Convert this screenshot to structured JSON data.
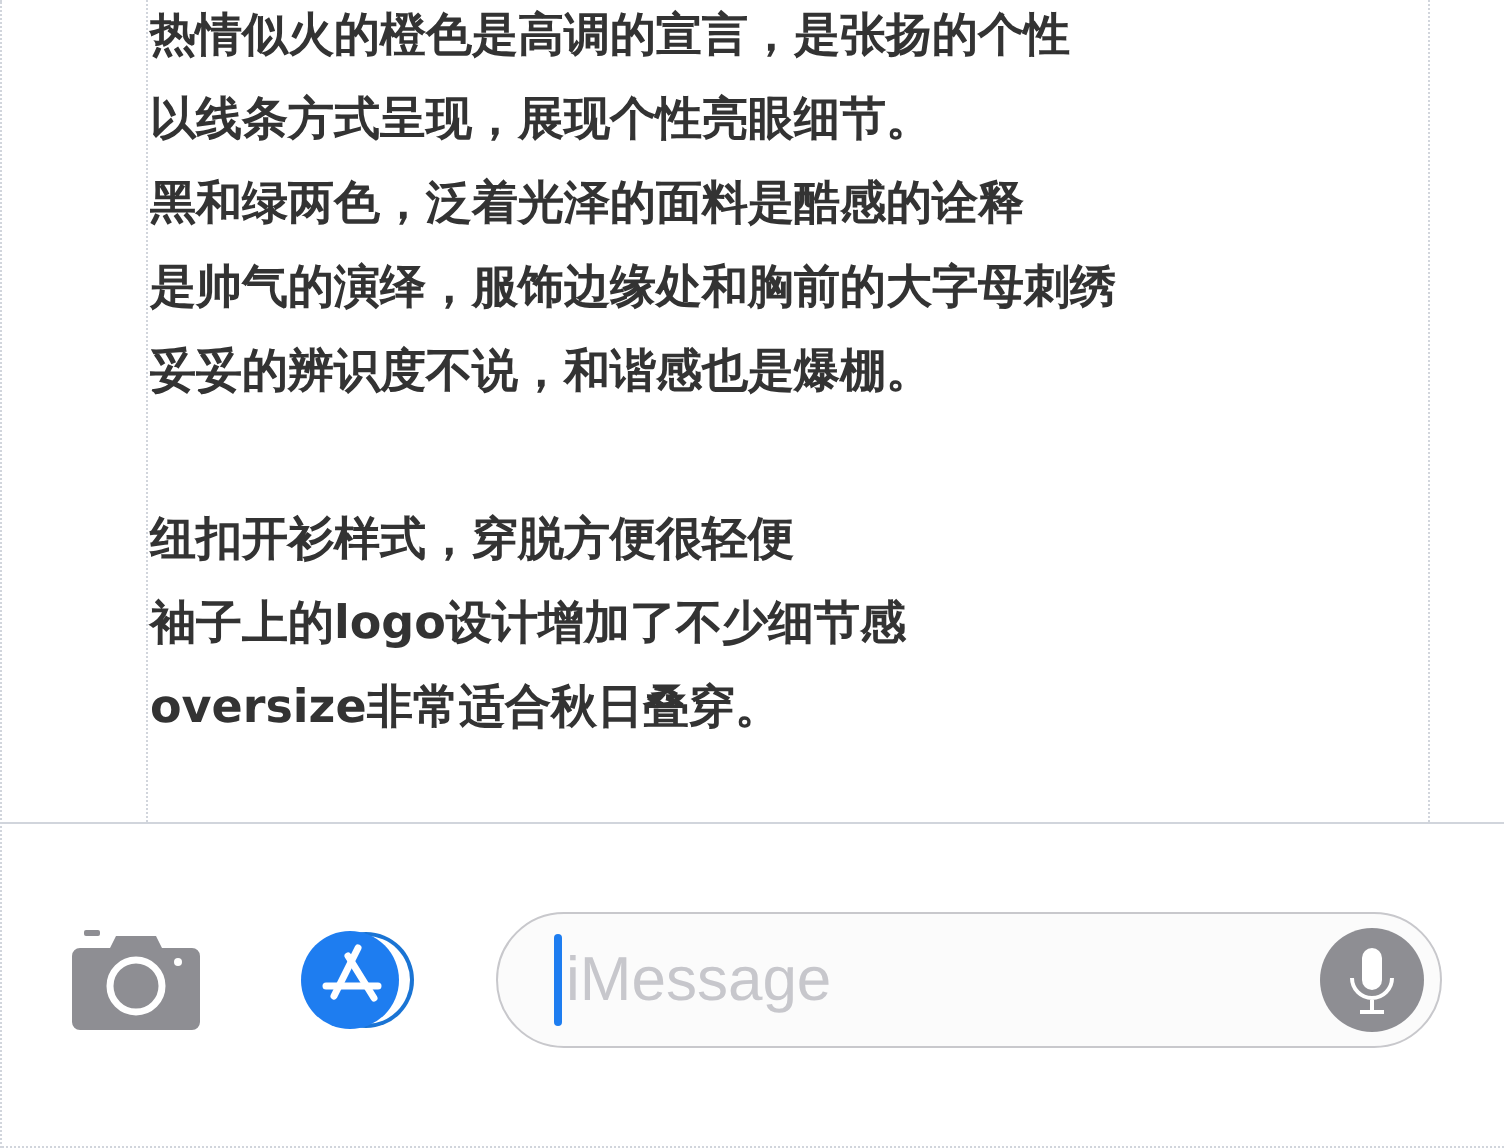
{
  "paragraphs": [
    {
      "lines": [
        "热情似火的橙色是高调的宣言，是张扬的个性",
        "以线条方式呈现，展现个性亮眼细节。",
        "黑和绿两色，泛着光泽的面料是酷感的诠释",
        "是帅气的演绎，服饰边缘处和胸前的大字母刺绣",
        "妥妥的辨识度不说，和谐感也是爆棚。"
      ]
    },
    {
      "lines": [
        "纽扣开衫样式，穿脱方便很轻便",
        "袖子上的logo设计增加了不少细节感",
        "oversize非常适合秋日叠穿。"
      ]
    }
  ],
  "composer": {
    "placeholder": "iMessage"
  }
}
